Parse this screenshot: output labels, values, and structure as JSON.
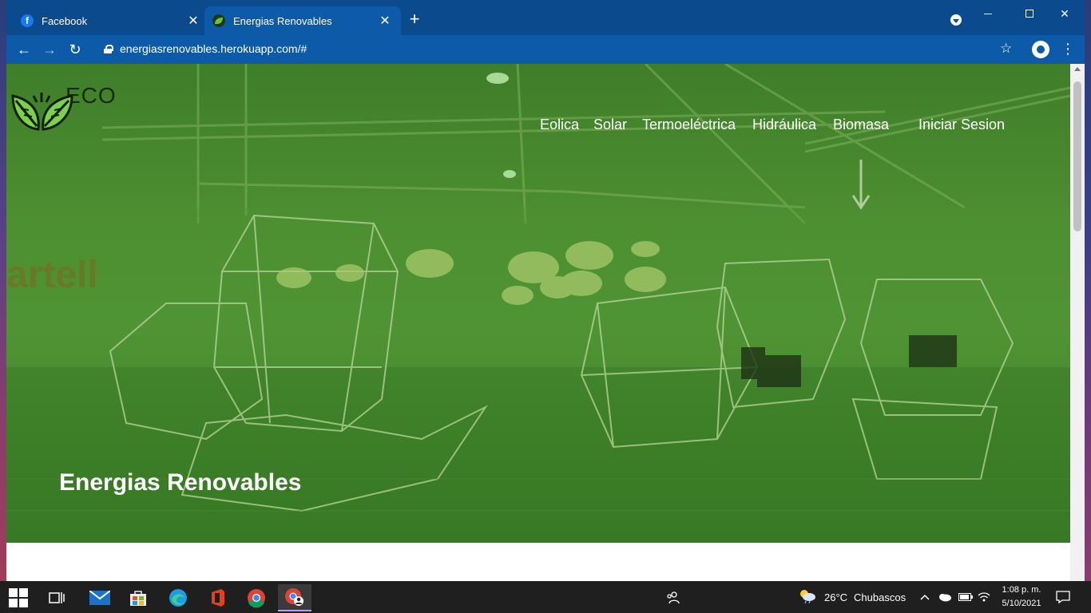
{
  "browser": {
    "tabs": [
      {
        "title": "Facebook",
        "icon": "facebook-icon",
        "active": false
      },
      {
        "title": "Energias Renovables",
        "icon": "eco-leaf-icon",
        "active": true
      }
    ],
    "new_tab_label": "+",
    "url": "energiasrenovables.herokuapp.com/#",
    "colors": {
      "tabbar": "#0b4a8c",
      "toolbar": "#0d5ba8"
    }
  },
  "site": {
    "logo_text": "ECO",
    "nav": [
      "Eolica",
      "Solar",
      "Termoeléctrica",
      "Hidráulica",
      "Biomasa"
    ],
    "login": "Iniciar Sesion",
    "hero_title": "Energias Renovables",
    "hero_overlay_color": "#4c8f32"
  },
  "taskbar": {
    "weather_temp": "26°C",
    "weather_text": "Chubascos",
    "time": "1:08 p. m.",
    "date": "5/10/2021",
    "apps": [
      "windows-start",
      "task-view",
      "mail",
      "microsoft-store",
      "edge",
      "office",
      "chrome",
      "chrome-profile"
    ]
  }
}
